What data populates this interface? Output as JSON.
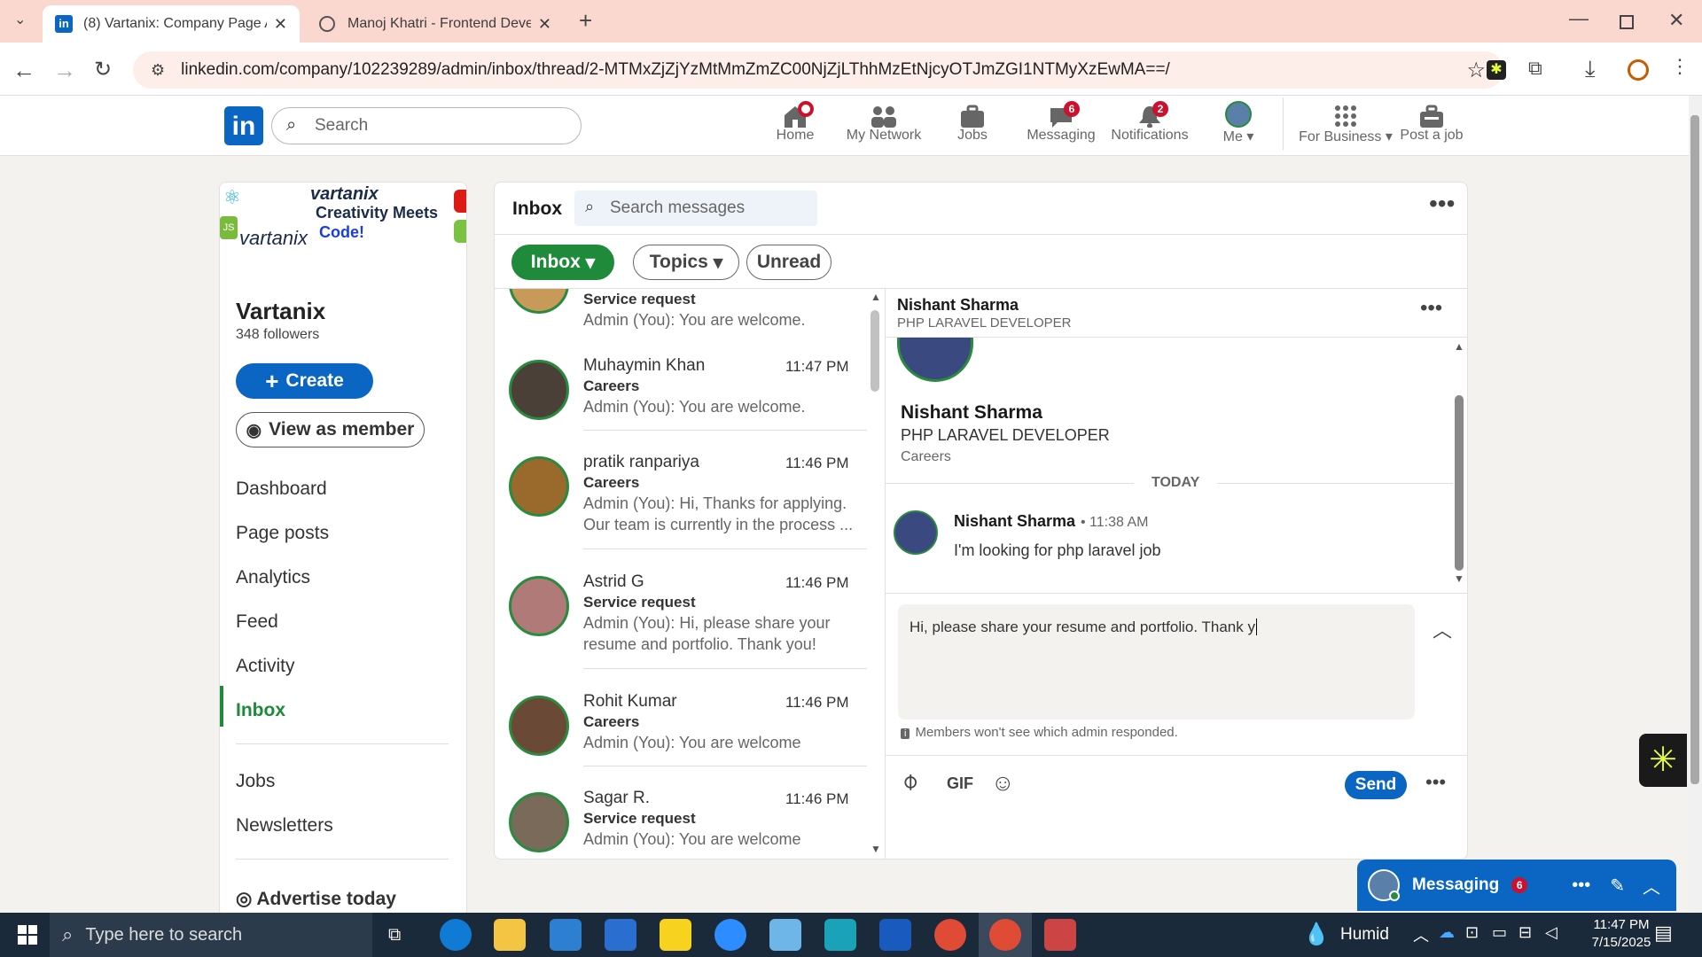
{
  "browser": {
    "tabs": [
      {
        "title": "(8) Vartanix: Company Page Ad"
      },
      {
        "title": "Manoj Khatri - Frontend Develo"
      }
    ],
    "url": "linkedin.com/company/102239289/admin/inbox/thread/2-MTMxZjZjYzMtMmZmZC00NjZjLThhMzEtNjcyOTJmZGI1NTMyXzEwMA==/"
  },
  "nav": {
    "search_placeholder": "Search",
    "items": [
      {
        "label": "Home",
        "icon": "home-icon"
      },
      {
        "label": "My Network",
        "icon": "network-icon"
      },
      {
        "label": "Jobs",
        "icon": "briefcase-icon"
      },
      {
        "label": "Messaging",
        "icon": "message-icon",
        "badge": "6"
      },
      {
        "label": "Notifications",
        "icon": "bell-icon",
        "badge": "2"
      },
      {
        "label": "Me",
        "icon": "avatar"
      },
      {
        "label": "For Business",
        "icon": "grid-icon"
      },
      {
        "label": "Post a job",
        "icon": "post-job-icon"
      }
    ]
  },
  "company": {
    "banner_line1": "vartanix",
    "banner_line2": "Creativity Meets",
    "banner_line3": "Code!",
    "banner_logo": "vartanix",
    "name": "Vartanix",
    "followers": "348 followers",
    "create_label": "Create",
    "view_member_label": "View as member",
    "menu": [
      "Dashboard",
      "Page posts",
      "Analytics",
      "Feed",
      "Activity",
      "Inbox"
    ],
    "menu2": [
      "Jobs",
      "Newsletters"
    ],
    "advertise": "Advertise today"
  },
  "inbox": {
    "title": "Inbox",
    "search_placeholder": "Search messages",
    "filters": [
      "Inbox",
      "Topics",
      "Unread"
    ],
    "conversations": [
      {
        "name": "",
        "time": "",
        "topic": "Service request",
        "preview": "Admin (You): You are welcome."
      },
      {
        "name": "Muhaymin Khan",
        "time": "11:47 PM",
        "topic": "Careers",
        "preview": "Admin (You): You are welcome."
      },
      {
        "name": "pratik ranpariya",
        "time": "11:46 PM",
        "topic": "Careers",
        "preview": "Admin (You): Hi, Thanks for applying. Our team is currently in the process ..."
      },
      {
        "name": "Astrid G",
        "time": "11:46 PM",
        "topic": "Service request",
        "preview": "Admin (You): Hi, please share your resume and portfolio. Thank you!"
      },
      {
        "name": "Rohit Kumar",
        "time": "11:46 PM",
        "topic": "Careers",
        "preview": "Admin (You): You are welcome"
      },
      {
        "name": "Sagar R.",
        "time": "11:46 PM",
        "topic": "Service request",
        "preview": "Admin (You): You are welcome"
      }
    ]
  },
  "thread": {
    "header_name": "Nishant Sharma",
    "header_title": "PHP LARAVEL DEVELOPER",
    "profile_name": "Nishant Sharma",
    "profile_title": "PHP LARAVEL DEVELOPER",
    "profile_topic": "Careers",
    "day_divider": "TODAY",
    "message_sender": "Nishant Sharma",
    "message_time": "• 11:38 AM",
    "message_text": "I'm looking for php laravel job",
    "compose_text": "Hi, please share your resume and portfolio. Thank y",
    "admin_note": "Members won't see which admin responded.",
    "gif_label": "GIF",
    "send_label": "Send"
  },
  "dock": {
    "label": "Messaging",
    "badge": "6"
  },
  "taskbar": {
    "search_placeholder": "Type here to search",
    "weather": "Humid",
    "time": "11:47 PM",
    "date": "7/15/2025"
  },
  "colors": {
    "linkedin_blue": "#0a66c2",
    "inbox_green": "#1f8a3a",
    "badge_red": "#cb112d"
  }
}
